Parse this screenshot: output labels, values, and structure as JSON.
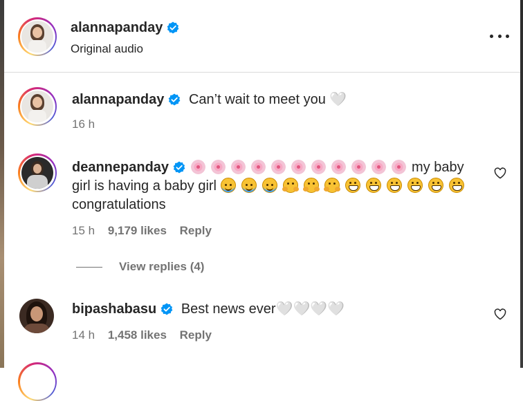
{
  "header": {
    "username": "alannapanday",
    "subtitle": "Original audio",
    "more_icon": "more-horizontal-icon"
  },
  "comments": [
    {
      "username": "alannapanday",
      "text": "Can’t wait to meet you 🤍",
      "time": "16 h"
    },
    {
      "username": "deannepanday",
      "emojis_line1": [
        "cherry-blossom",
        "cherry-blossom",
        "cherry-blossom",
        "cherry-blossom",
        "cherry-blossom",
        "cherry-blossom",
        "cherry-blossom",
        "cherry-blossom",
        "cherry-blossom",
        "cherry-blossom",
        "cherry-blossom"
      ],
      "text_a": "my baby",
      "text_b": "girl is having a baby girl",
      "text_c": "congratulations",
      "time": "15 h",
      "likes": "9,179 likes",
      "reply": "Reply",
      "view_replies": "View replies (4)"
    },
    {
      "username": "bipashabasu",
      "text": "Best news ever🤍🤍🤍🤍",
      "time": "14 h",
      "likes": "1,458 likes",
      "reply": "Reply"
    }
  ],
  "colors": {
    "verified": "#0095f6",
    "meta": "#737373",
    "text": "#262626"
  }
}
